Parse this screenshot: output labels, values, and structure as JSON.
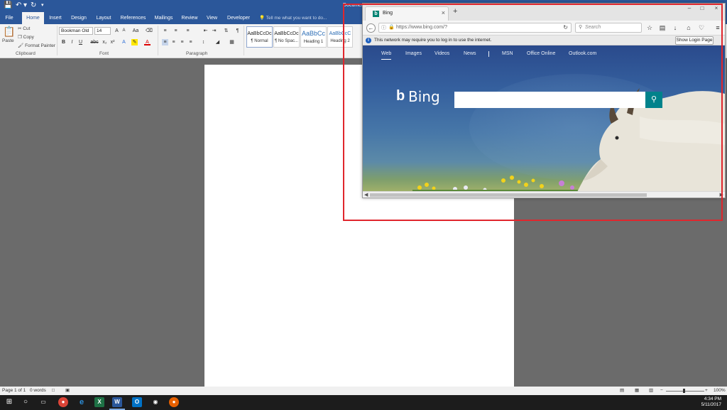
{
  "word": {
    "doc_title": "Document",
    "tabs": [
      "File",
      "Home",
      "Insert",
      "Design",
      "Layout",
      "References",
      "Mailings",
      "Review",
      "View",
      "Developer"
    ],
    "tell_me": "Tell me what you want to do...",
    "clipboard": {
      "paste": "Paste",
      "cut": "Cut",
      "copy": "Copy",
      "format_painter": "Format Painter",
      "label": "Clipboard"
    },
    "font": {
      "name": "Bookman Old",
      "size": "14",
      "label": "Font"
    },
    "paragraph": {
      "label": "Paragraph"
    },
    "styles": [
      {
        "sample": "AaBbCcDc",
        "name": "¶ Normal"
      },
      {
        "sample": "AaBbCcDc",
        "name": "¶ No Spac..."
      },
      {
        "sample": "AaBbCc",
        "name": "Heading 1"
      },
      {
        "sample": "AaBbCcC",
        "name": "Heading 2"
      }
    ],
    "status": {
      "page": "Page 1 of 1",
      "words": "0 words",
      "zoom": "100%"
    }
  },
  "firefox": {
    "tab_title": "Bing",
    "url": "https://www.bing.com/?",
    "search_placeholder": "Search",
    "notice": "This network may require you to log in to use the internet.",
    "login_button": "Show Login Page"
  },
  "bing": {
    "nav": [
      "Web",
      "Images",
      "Videos",
      "News",
      "MSN",
      "Office Online",
      "Outlook.com"
    ],
    "logo": "Bing"
  },
  "taskbar": {
    "time": "4:34 PM",
    "date": "5/11/2017"
  },
  "colors": {
    "word_blue": "#2b579a",
    "bing_teal": "#00828b",
    "highlight_red": "#e0262d"
  }
}
